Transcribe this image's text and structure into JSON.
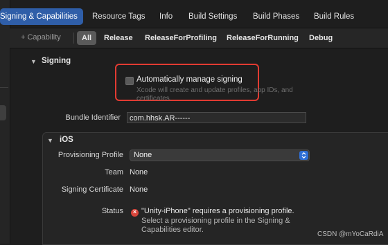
{
  "tabs": [
    "Signing & Capabilities",
    "Resource Tags",
    "Info",
    "Build Settings",
    "Build Phases",
    "Build Rules"
  ],
  "filter": {
    "add_capability": "+ Capability",
    "configs": [
      "All",
      "Release",
      "ReleaseForProfiling",
      "ReleaseForRunning",
      "Debug"
    ]
  },
  "signing": {
    "title": "Signing",
    "auto_manage": "Automatically manage signing",
    "auto_hint": "Xcode will create and update profiles, app IDs, and certificates.",
    "bundle_label": "Bundle Identifier",
    "bundle_value": "com.hhsk.AR------"
  },
  "ios": {
    "title": "iOS",
    "profile_label": "Provisioning Profile",
    "profile_value": "None",
    "team_label": "Team",
    "team_value": "None",
    "cert_label": "Signing Certificate",
    "cert_value": "None",
    "status_label": "Status",
    "status_error": "\"Unity-iPhone\" requires a provisioning profile.",
    "status_detail": "Select a provisioning profile in the Signing & Capabilities editor."
  },
  "watermark": "CSDN @mYoCaRdiA",
  "colors": {
    "accent": "#2f5ea8",
    "highlight": "#e23b32",
    "error": "#d8453b"
  }
}
